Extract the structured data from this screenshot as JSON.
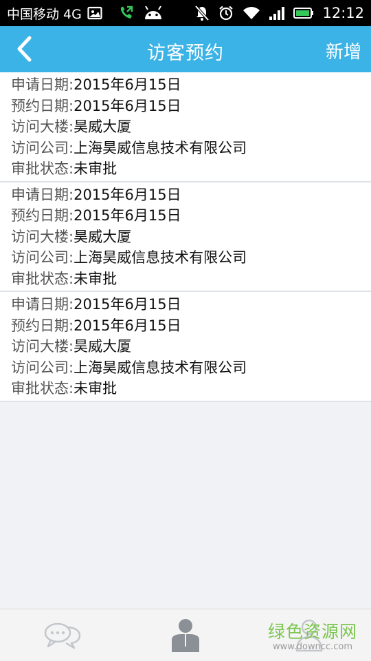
{
  "status_bar": {
    "carrier": "中国移动 4G",
    "time": "12:12",
    "icons": [
      "image-icon",
      "call-icon",
      "android-icon",
      "mute-icon",
      "alarm-icon",
      "wifi-icon",
      "signal-icon",
      "battery-icon"
    ]
  },
  "header": {
    "title": "访客预约",
    "add_label": "新增",
    "back_icon": "chevron-left-icon",
    "bg_color": "#3cb3e6"
  },
  "records": [
    {
      "apply_date_label": "申请日期:",
      "apply_date": "2015年6月15日",
      "visit_date_label": "预约日期:",
      "visit_date": "2015年6月15日",
      "building_label": "访问大楼:",
      "building": "昊威大厦",
      "company_label": "访问公司:",
      "company": "上海昊威信息技术有限公司",
      "status_label": "审批状态:",
      "status": "未审批"
    },
    {
      "apply_date_label": "申请日期:",
      "apply_date": "2015年6月15日",
      "visit_date_label": "预约日期:",
      "visit_date": "2015年6月15日",
      "building_label": "访问大楼:",
      "building": "昊威大厦",
      "company_label": "访问公司:",
      "company": "上海昊威信息技术有限公司",
      "status_label": "审批状态:",
      "status": "未审批"
    },
    {
      "apply_date_label": "申请日期:",
      "apply_date": "2015年6月15日",
      "visit_date_label": "预约日期:",
      "visit_date": "2015年6月15日",
      "building_label": "访问大楼:",
      "building": "昊威大厦",
      "company_label": "访问公司:",
      "company": "上海昊威信息技术有限公司",
      "status_label": "审批状态:",
      "status": "未审批"
    }
  ],
  "bottom_nav": {
    "items": [
      "chat-bubbles-icon",
      "person-card-icon",
      "contacts-icon"
    ]
  },
  "watermark": {
    "main": "绿色资源网",
    "sub": "www.downcc.com"
  }
}
